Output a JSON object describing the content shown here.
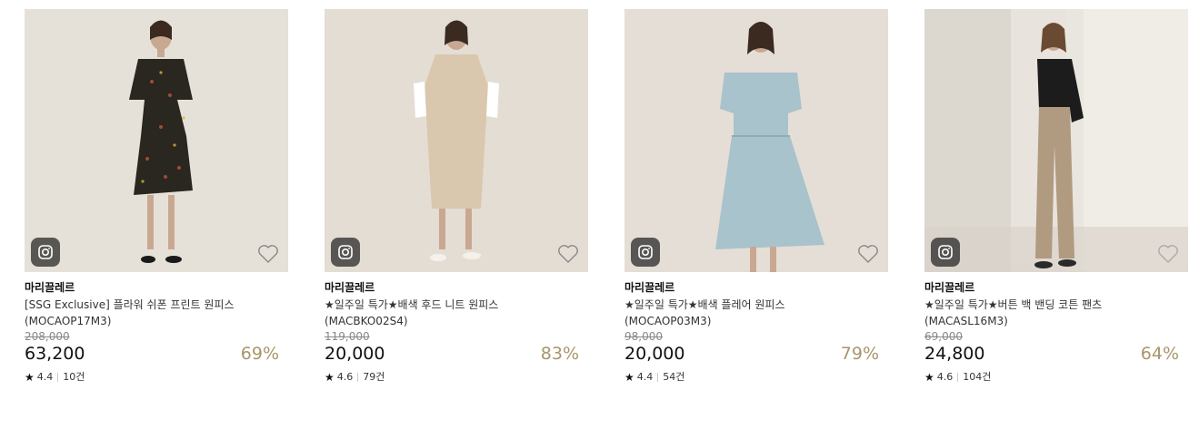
{
  "products": [
    {
      "brand": "마리끌레르",
      "name_line1": "[SSG Exclusive] 플라워 쉬폰 프린트 원피스",
      "name_line2": "(MOCAOP17M3)",
      "original_price": "208,000",
      "price": "63,200",
      "discount": "69%",
      "rating": "4.4",
      "reviews": "10건",
      "bg_color": "#e6e1d8",
      "garment_color": "#2a2620",
      "instagram_icon": "instagram-icon",
      "wishlist_icon": "heart-icon"
    },
    {
      "brand": "마리끌레르",
      "name_line1": "★일주일 특가★배색 후드 니트 원피스",
      "name_line2": "(MACBKO02S4)",
      "original_price": "119,000",
      "price": "20,000",
      "discount": "83%",
      "rating": "4.6",
      "reviews": "79건",
      "bg_color": "#e4ddd4",
      "garment_color": "#d9c7ae",
      "instagram_icon": "instagram-icon",
      "wishlist_icon": "heart-icon"
    },
    {
      "brand": "마리끌레르",
      "name_line1": "★일주일 특가★배색 플레어 원피스",
      "name_line2": "(MOCAOP03M3)",
      "original_price": "98,000",
      "price": "20,000",
      "discount": "79%",
      "rating": "4.4",
      "reviews": "54건",
      "bg_color": "#e5ded6",
      "garment_color": "#a8c3cc",
      "instagram_icon": "instagram-icon",
      "wishlist_icon": "heart-icon"
    },
    {
      "brand": "마리끌레르",
      "name_line1": "★일주일 특가★버튼 백 밴딩 코튼 팬츠",
      "name_line2": "(MACASL16M3)",
      "original_price": "69,000",
      "price": "24,800",
      "discount": "64%",
      "rating": "4.6",
      "reviews": "104건",
      "bg_color": "#e9e5df",
      "garment_color": "#b09a80",
      "instagram_icon": "instagram-icon",
      "wishlist_icon": "heart-icon"
    }
  ],
  "colors": {
    "discount": "#a8966a",
    "strike": "#888888"
  }
}
